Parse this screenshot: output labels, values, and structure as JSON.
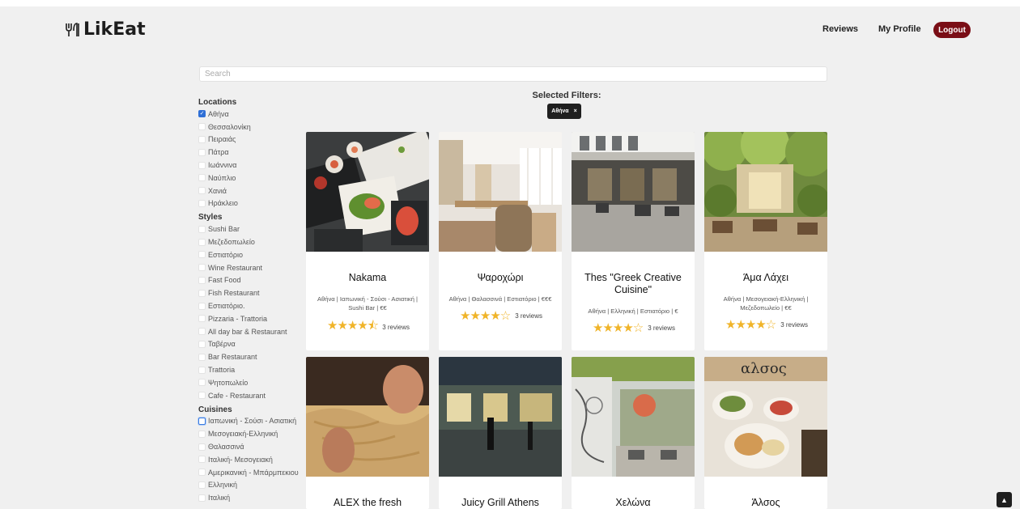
{
  "brand": "LikEat",
  "nav": {
    "reviews": "Reviews",
    "profile": "My Profile",
    "logout": "Logout"
  },
  "search": {
    "placeholder": "Search",
    "value": ""
  },
  "sidebar": {
    "locations_title": "Locations",
    "locations": [
      {
        "label": "Αθήνα",
        "checked": true
      },
      {
        "label": "Θεσσαλονίκη",
        "checked": false
      },
      {
        "label": "Πειραιάς",
        "checked": false
      },
      {
        "label": "Πάτρα",
        "checked": false
      },
      {
        "label": "Ιωάννινα",
        "checked": false
      },
      {
        "label": "Ναύπλιο",
        "checked": false
      },
      {
        "label": "Χανιά",
        "checked": false
      },
      {
        "label": "Ηράκλειο",
        "checked": false
      }
    ],
    "styles_title": "Styles",
    "styles": [
      {
        "label": "Sushi Bar"
      },
      {
        "label": "Μεζεδοπωλείο"
      },
      {
        "label": "Εστιατόριο"
      },
      {
        "label": "Wine Restaurant"
      },
      {
        "label": "Fast Food"
      },
      {
        "label": "Fish Restaurant"
      },
      {
        "label": "Εστιατόριο."
      },
      {
        "label": "Pizzaria - Trattoria"
      },
      {
        "label": "All day bar & Restaurant"
      },
      {
        "label": "Ταβέρνα"
      },
      {
        "label": "Bar Restaurant"
      },
      {
        "label": "Trattoria"
      },
      {
        "label": "Ψητοπωλείο"
      },
      {
        "label": "Cafe - Restaurant"
      }
    ],
    "cuisines_title": "Cuisines",
    "cuisines": [
      {
        "label": "Ιαπωνική - Σούσι - Ασιατική"
      },
      {
        "label": "Μεσογειακή-Ελληνική"
      },
      {
        "label": "Θαλασσινά"
      },
      {
        "label": "Ιταλική- Μεσογειακή"
      },
      {
        "label": "Αμερικανική - Μπάρμπεκιου"
      },
      {
        "label": "Ελληνική"
      },
      {
        "label": "Ιταλική"
      }
    ]
  },
  "filters": {
    "title": "Selected Filters:",
    "chips": [
      {
        "label": "Αθήνα",
        "remove": "×"
      }
    ]
  },
  "restaurants": [
    {
      "name": "Nakama",
      "meta": "Αθήνα | Ιαπωνική - Σούσι - Ασιατική | Sushi Bar | €€",
      "rating": 4.5,
      "reviews": "3 reviews"
    },
    {
      "name": "Ψαροχώρι",
      "meta": "Αθήνα | Θαλασσινά | Εστιατόριο | €€€",
      "rating": 4,
      "reviews": "3 reviews"
    },
    {
      "name": "Thes \"Greek Creative Cuisine\"",
      "meta": "Αθήνα | Ελληνική | Εστιατόριο | €",
      "rating": 4,
      "reviews": "3 reviews"
    },
    {
      "name": "Άμα Λάχει",
      "meta": "Αθήνα | Μεσογειακή-Ελληνική | Μεζεδοπωλείο | €€",
      "rating": 4,
      "reviews": "3 reviews"
    },
    {
      "name": "ALEX the fresh"
    },
    {
      "name": "Juicy Grill Athens"
    },
    {
      "name": "Χελώνα"
    },
    {
      "name": "Άλσος"
    }
  ],
  "scroll_top": "▲",
  "colors": {
    "accent": "#7a0e16",
    "star": "#f0b429",
    "check": "#2f6fd6",
    "background": "#f0f0f0"
  }
}
